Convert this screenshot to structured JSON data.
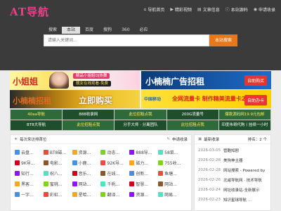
{
  "app": {
    "logo": "AT导航"
  },
  "topnav": [
    {
      "icon": "home-icon",
      "glyph": "⌂",
      "label": "导航首页"
    },
    {
      "icon": "video-icon",
      "glyph": "▶",
      "label": "精彩视频"
    },
    {
      "icon": "document-icon",
      "glyph": "▤",
      "label": "文章信息"
    },
    {
      "icon": "info-icon",
      "glyph": "ⓘ",
      "label": "本站源码"
    },
    {
      "icon": "user-icon",
      "glyph": "◉",
      "label": "申请收录"
    }
  ],
  "search": {
    "tabs": [
      "搜索",
      "本站",
      "百度",
      "搜狗",
      "360",
      "必应"
    ],
    "active_tab": "本站",
    "placeholder": "请输入关键词...",
    "button": "本站搜索"
  },
  "banners": {
    "b1": {
      "big": "小姐姐",
      "line1": "精品小姐姐DJ热舞",
      "line2": "靓女在线观看-免费"
    },
    "b2": {
      "big": "小楠楠广告招租",
      "button": "自助购买"
    },
    "b3": {
      "big": "小楠楠招租",
      "big2": "立即购买"
    },
    "b4": {
      "brand": "中国移动",
      "big": "全网流量卡 制作精美流量卡200G/月",
      "button": "自助办卡"
    }
  },
  "link_grid": [
    "40aa导航",
    "888收录网",
    "此位招租点我",
    "200G流量号",
    "爆款源码网19.9元包邮",
    "BT8大导航",
    "此位招租点我",
    "分手大师 · 分离团队",
    "此位招租点我",
    "印度伟哥代购丨挂续一小时"
  ],
  "panel_left": {
    "title": "每次来访排首位",
    "action": "申请收录",
    "sites": [
      "云盘...",
      "BT8磁...",
      "资源...",
      "动态...",
      "888导...",
      "58菜...",
      "9K导...",
      "电影...",
      "小鹿...",
      "92K导...",
      "磁力...",
      "755收...",
      "知行...",
      "祝八...",
      "音乐...",
      "在线...",
      "创新...",
      "鱼塘...",
      "黑客...",
      "蜜桃...",
      "网站...",
      "千帆...",
      "智慧...",
      "网站...",
      "一字...",
      "彩虹...",
      "星哈...",
      "翻译...",
      "资源...",
      "网易..."
    ]
  },
  "panel_right": {
    "title": "最新收录",
    "pager": "排名：2 个",
    "news": [
      {
        "date": "2026-03-05",
        "title": "管酷知剧"
      },
      {
        "date": "2026-02-28",
        "title": "美狗神主器"
      },
      {
        "date": "2026-02-28",
        "title": "网站搜索 - Powered by"
      },
      {
        "date": "2026-02-26",
        "title": "北咸导航网 · 技术导航"
      },
      {
        "date": "2026-02-24",
        "title": "网址收录站-全新展示"
      },
      {
        "date": "2026-02-23",
        "title": "知识星球导航 ..."
      }
    ]
  },
  "colors": {
    "topbar": "#3b3b3b",
    "logo": "#e8418a",
    "search_button": "#e3781d",
    "grid_green": "#2f6b3a"
  }
}
